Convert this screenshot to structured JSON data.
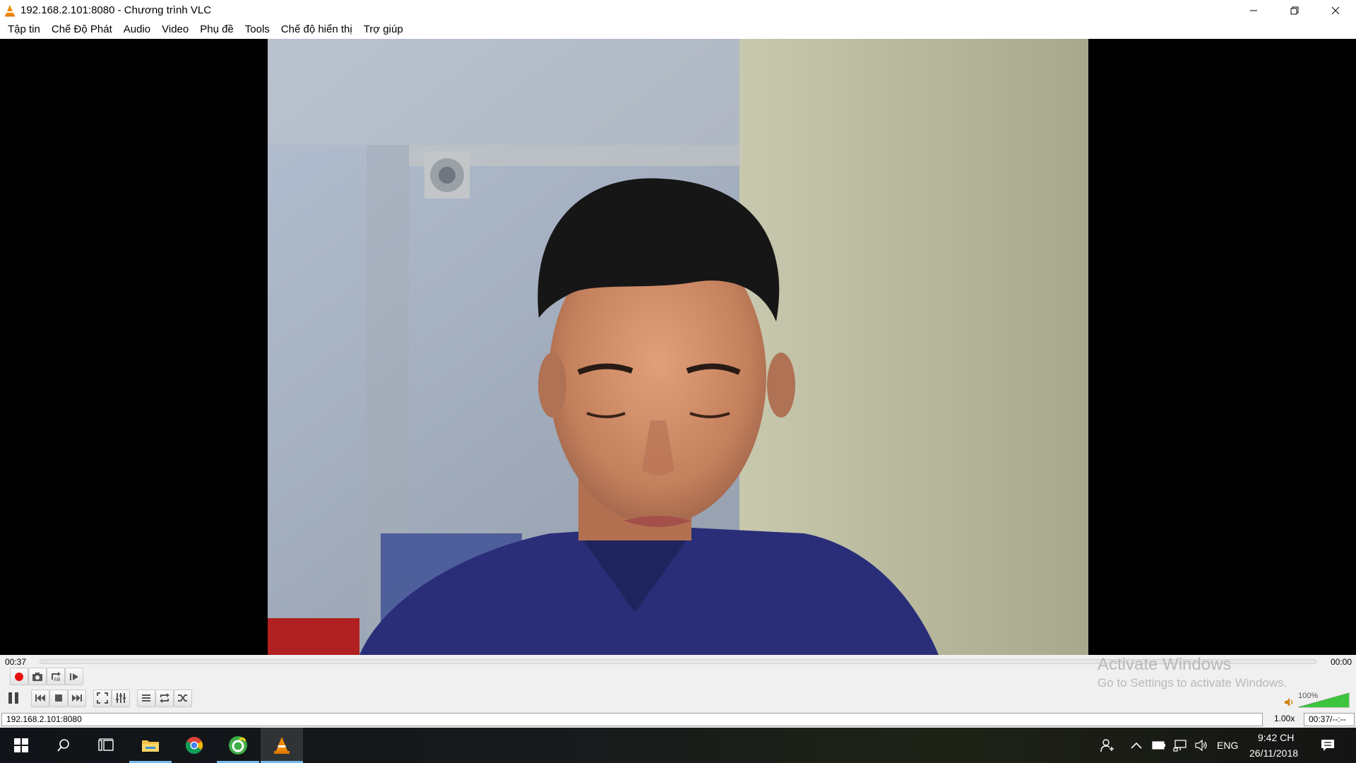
{
  "window": {
    "title": "192.168.2.101:8080 - Chương trình VLC",
    "controls": [
      "minimize-icon",
      "restore-icon",
      "close-icon"
    ]
  },
  "menu": {
    "items": [
      "Tập tin",
      "Chế Độ Phát",
      "Audio",
      "Video",
      "Phụ đề",
      "Tools",
      "Chế độ hiển thị",
      "Trợ giúp"
    ]
  },
  "playback": {
    "elapsed": "00:37",
    "remaining": "00:00",
    "progress_fraction": 0.0
  },
  "volume": {
    "percent_label": "100%",
    "level": 1.0
  },
  "watermark": {
    "line1": "Activate Windows",
    "line2": "Go to Settings to activate Windows."
  },
  "status": {
    "media": "192.168.2.101:8080",
    "speed": "1.00x",
    "time": "00:37/--:--"
  },
  "taskbar": {
    "language": "ENG",
    "clock_time": "9:42 CH",
    "clock_date": "26/11/2018",
    "apps": [
      "file-explorer-icon",
      "chrome-icon",
      "coccoc-icon",
      "vlc-icon"
    ]
  },
  "colors": {
    "record": "#e81010",
    "vlc_orange": "#f08a00",
    "volume_green": "#3cc43c",
    "taskbar_accent": "#76b9ed"
  }
}
